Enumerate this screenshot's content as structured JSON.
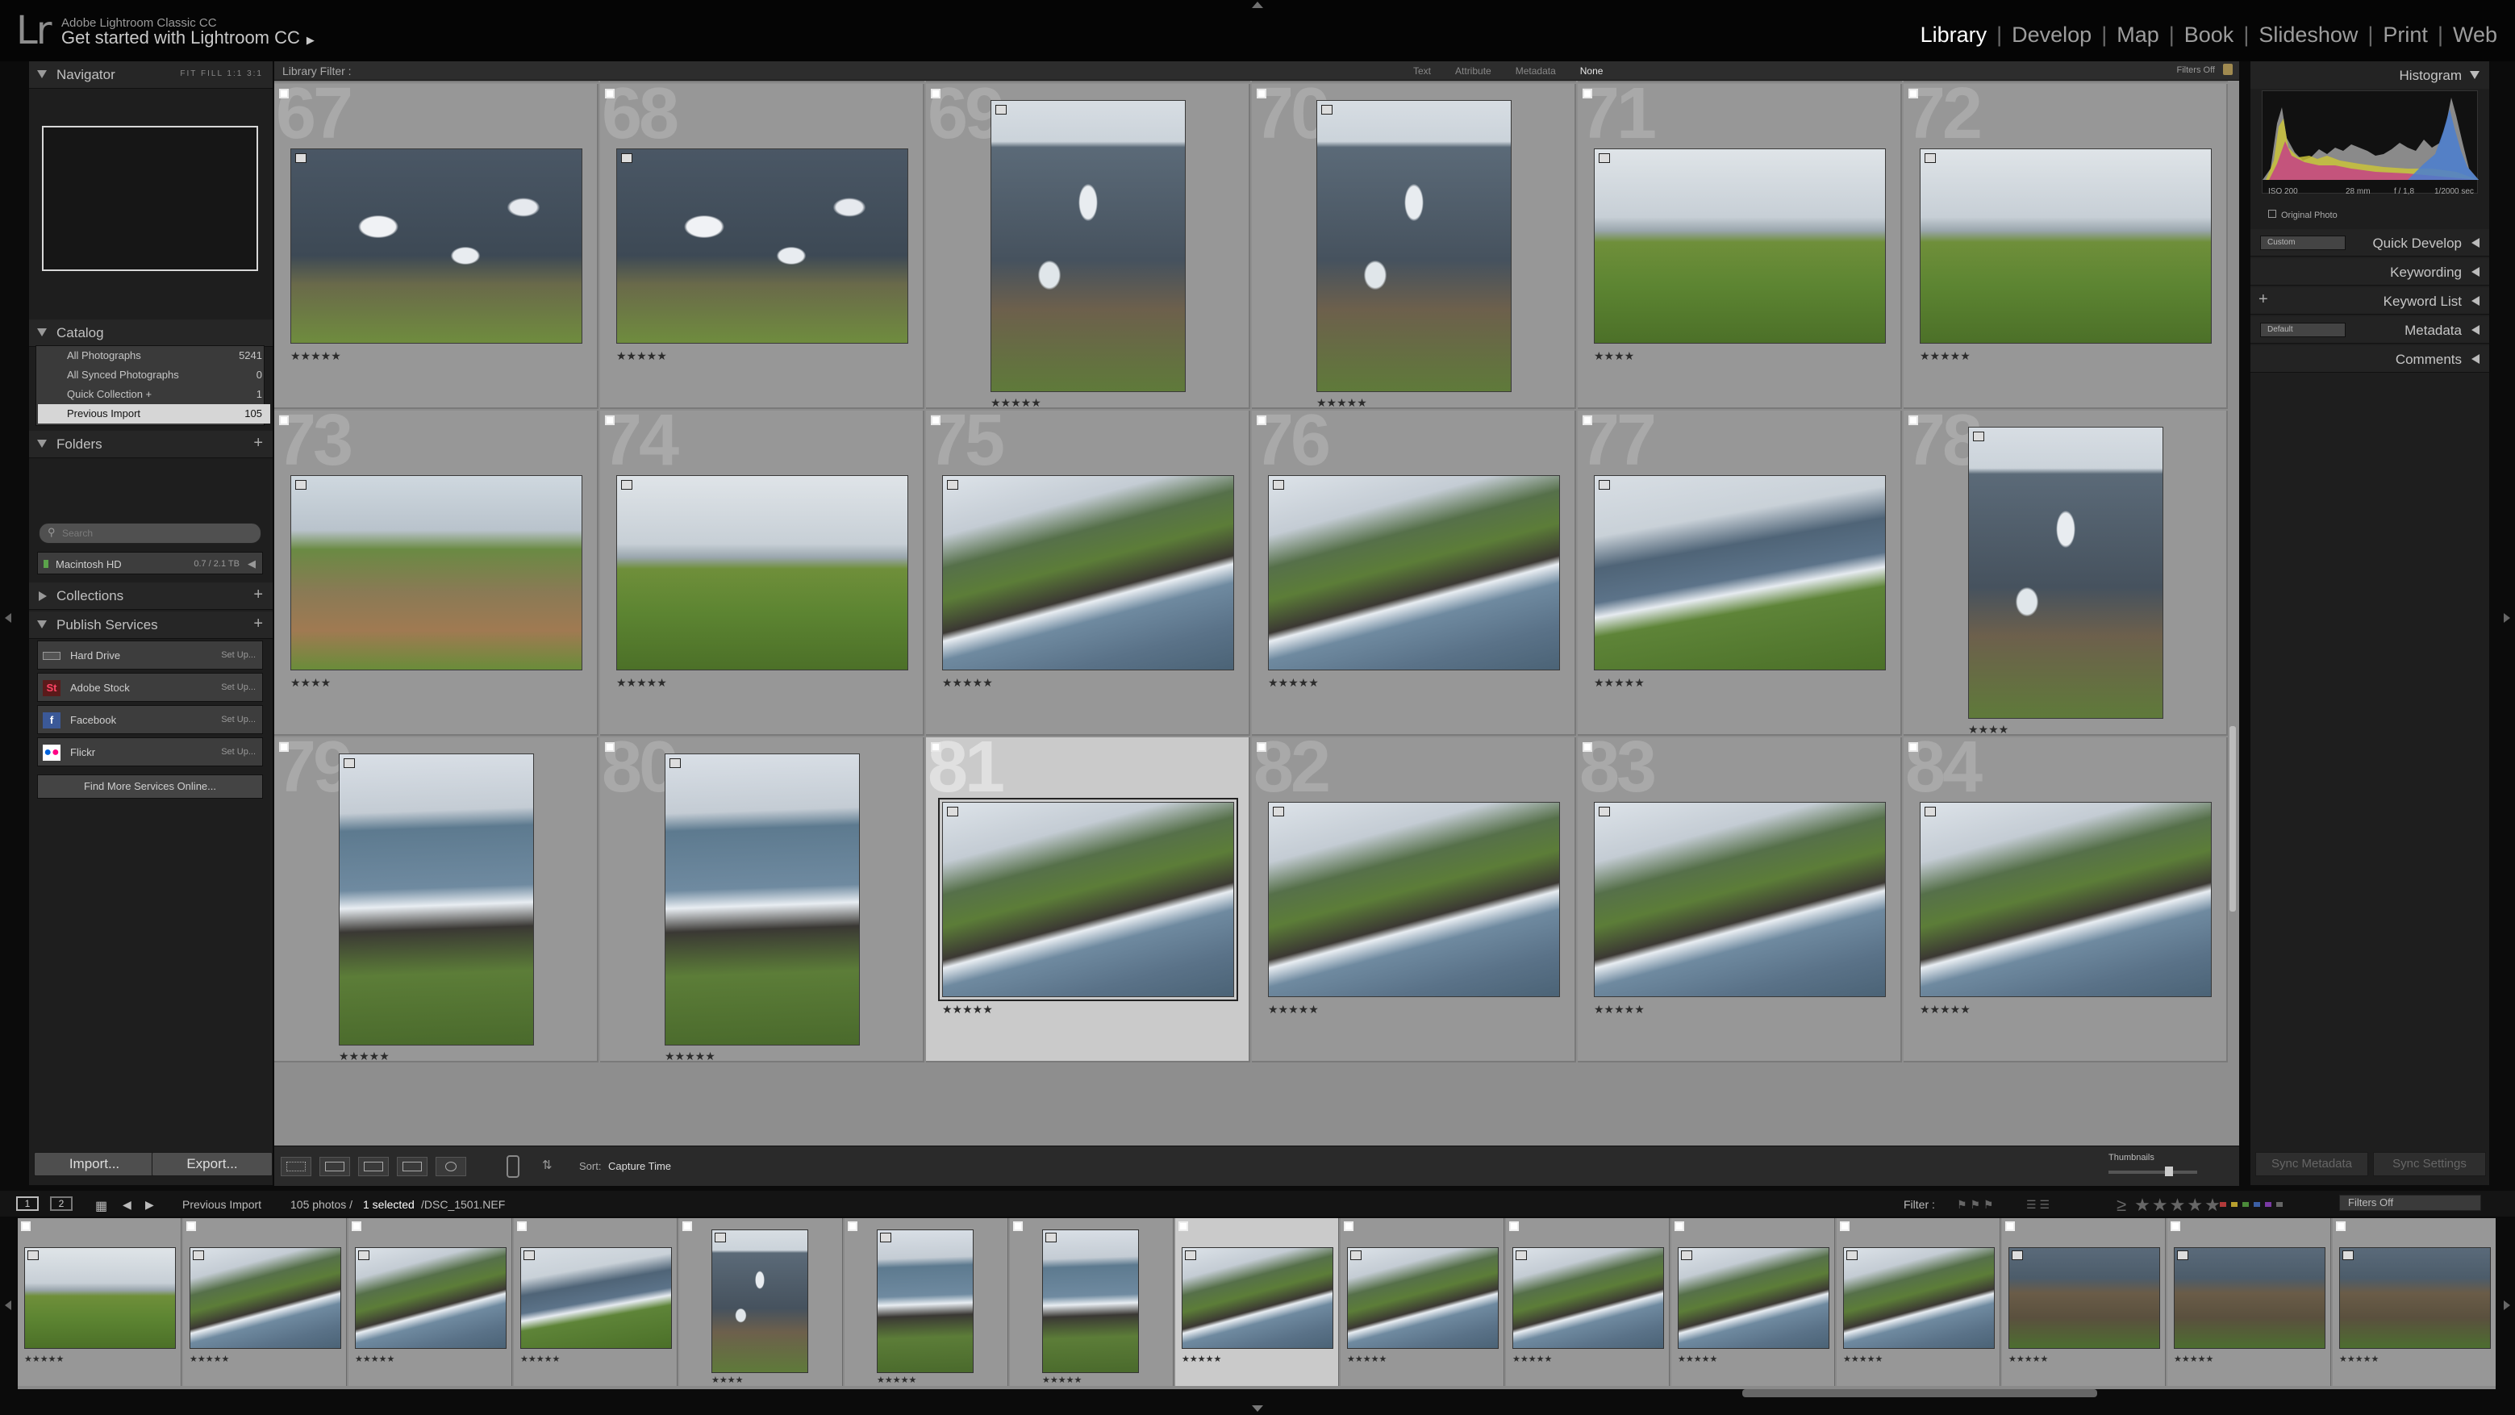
{
  "header": {
    "logo": "Lr",
    "product": "Adobe Lightroom Classic CC",
    "identity": "Get started with Lightroom CC",
    "modules": [
      "Library",
      "Develop",
      "Map",
      "Book",
      "Slideshow",
      "Print",
      "Web"
    ],
    "active_module": "Library"
  },
  "left": {
    "navigator": {
      "title": "Navigator",
      "options": "FIT  FILL  1:1  3:1"
    },
    "catalog": {
      "title": "Catalog",
      "items": [
        {
          "label": "All Photographs",
          "count": "5241"
        },
        {
          "label": "All Synced Photographs",
          "count": "0"
        },
        {
          "label": "Quick Collection +",
          "count": "1"
        },
        {
          "label": "Previous Import",
          "count": "105"
        }
      ]
    },
    "folders": {
      "title": "Folders",
      "search_placeholder": "Search",
      "volume": "Macintosh HD",
      "volume_size": "0.7 / 2.1 TB"
    },
    "collections": {
      "title": "Collections"
    },
    "publish": {
      "title": "Publish Services",
      "services": [
        {
          "label": "Hard Drive",
          "action": "Set Up..."
        },
        {
          "label": "Adobe Stock",
          "action": "Set Up..."
        },
        {
          "label": "Facebook",
          "action": "Set Up..."
        },
        {
          "label": "Flickr",
          "action": "Set Up..."
        }
      ],
      "find_more": "Find More Services Online..."
    },
    "import_label": "Import...",
    "export_label": "Export..."
  },
  "filterbar": {
    "title": "Library Filter :",
    "tabs": [
      "Text",
      "Attribute",
      "Metadata",
      "None"
    ],
    "active": "None",
    "filters_off": "Filters Off"
  },
  "grid": {
    "top_stars": [
      "★★★★★",
      "★★★★★",
      "★★★★★",
      "★★★★",
      "★★★★★",
      "★★★★★"
    ],
    "rows": [
      [
        {
          "n": "67",
          "stars": "★★★★★",
          "kind": "sea",
          "orient": "land"
        },
        {
          "n": "68",
          "stars": "★★★★★",
          "kind": "sea",
          "orient": "land"
        },
        {
          "n": "69",
          "stars": "★★★★★",
          "kind": "seaP",
          "orient": "port"
        },
        {
          "n": "70",
          "stars": "★★★★★",
          "kind": "seaP",
          "orient": "port"
        },
        {
          "n": "71",
          "stars": "★★★★",
          "kind": "cliff",
          "orient": "land"
        },
        {
          "n": "72",
          "stars": "★★★★★",
          "kind": "cliff",
          "orient": "land"
        }
      ],
      [
        {
          "n": "73",
          "stars": "★★★★",
          "kind": "road",
          "orient": "land"
        },
        {
          "n": "74",
          "stars": "★★★★★",
          "kind": "cliff",
          "orient": "land"
        },
        {
          "n": "75",
          "stars": "★★★★★",
          "kind": "beach",
          "orient": "land"
        },
        {
          "n": "76",
          "stars": "★★★★★",
          "kind": "beach",
          "orient": "land"
        },
        {
          "n": "77",
          "stars": "★★★★★",
          "kind": "coast",
          "orient": "land"
        },
        {
          "n": "78",
          "stars": "★★★★",
          "kind": "seaP",
          "orient": "port"
        }
      ],
      [
        {
          "n": "79",
          "stars": "★★★★★",
          "kind": "beachP",
          "orient": "port"
        },
        {
          "n": "80",
          "stars": "★★★★★",
          "kind": "beachP",
          "orient": "port"
        },
        {
          "n": "81",
          "stars": "★★★★★",
          "kind": "beach",
          "orient": "land",
          "selected": true
        },
        {
          "n": "82",
          "stars": "★★★★★",
          "kind": "beach",
          "orient": "land"
        },
        {
          "n": "83",
          "stars": "★★★★★",
          "kind": "beach",
          "orient": "land"
        },
        {
          "n": "84",
          "stars": "★★★★★",
          "kind": "beach",
          "orient": "land"
        }
      ]
    ]
  },
  "toolbar": {
    "sort_label": "Sort:",
    "sort_value": "Capture Time",
    "thumbnails_label": "Thumbnails"
  },
  "right": {
    "histogram": {
      "title": "Histogram",
      "iso": "ISO 200",
      "focal": "28 mm",
      "aperture": "f / 1,8",
      "shutter": "1/2000 sec",
      "original": "Original Photo"
    },
    "quick_develop": {
      "title": "Quick Develop",
      "preset": "Custom"
    },
    "keywording": {
      "title": "Keywording"
    },
    "keyword_list": {
      "title": "Keyword List"
    },
    "metadata": {
      "title": "Metadata",
      "preset": "Default"
    },
    "comments": {
      "title": "Comments"
    },
    "sync_metadata": "Sync Metadata",
    "sync_settings": "Sync Settings"
  },
  "filmstrip_bar": {
    "monitor1": "1",
    "monitor2": "2",
    "source": "Previous Import",
    "count": "105 photos /",
    "selected": "1 selected",
    "file": "/DSC_1501.NEF",
    "filter_label": "Filter :",
    "filter_value": "Filters Off"
  },
  "filmstrip": [
    {
      "kind": "cliff",
      "orient": "land",
      "stars": "★★★★★"
    },
    {
      "kind": "beach",
      "orient": "land",
      "stars": "★★★★★"
    },
    {
      "kind": "beach",
      "orient": "land",
      "stars": "★★★★★"
    },
    {
      "kind": "coast",
      "orient": "land",
      "stars": "★★★★★"
    },
    {
      "kind": "seaP",
      "orient": "port",
      "stars": "★★★★"
    },
    {
      "kind": "beachP",
      "orient": "port",
      "stars": "★★★★★"
    },
    {
      "kind": "beachP",
      "orient": "port",
      "stars": "★★★★★"
    },
    {
      "kind": "beach",
      "orient": "land",
      "stars": "★★★★★",
      "selected": true
    },
    {
      "kind": "beach",
      "orient": "land",
      "stars": "★★★★★"
    },
    {
      "kind": "beach",
      "orient": "land",
      "stars": "★★★★★"
    },
    {
      "kind": "beach",
      "orient": "land",
      "stars": "★★★★★"
    },
    {
      "kind": "beach",
      "orient": "land",
      "stars": "★★★★★"
    },
    {
      "kind": "rock",
      "orient": "land",
      "stars": "★★★★★"
    },
    {
      "kind": "rock",
      "orient": "land",
      "stars": "★★★★★"
    },
    {
      "kind": "rock",
      "orient": "land",
      "stars": "★★★★★"
    }
  ],
  "colors": {
    "accent": "#ffffff",
    "selected_cell": "#cacaca",
    "cell": "#979797",
    "panel": "#1e1e1e"
  }
}
